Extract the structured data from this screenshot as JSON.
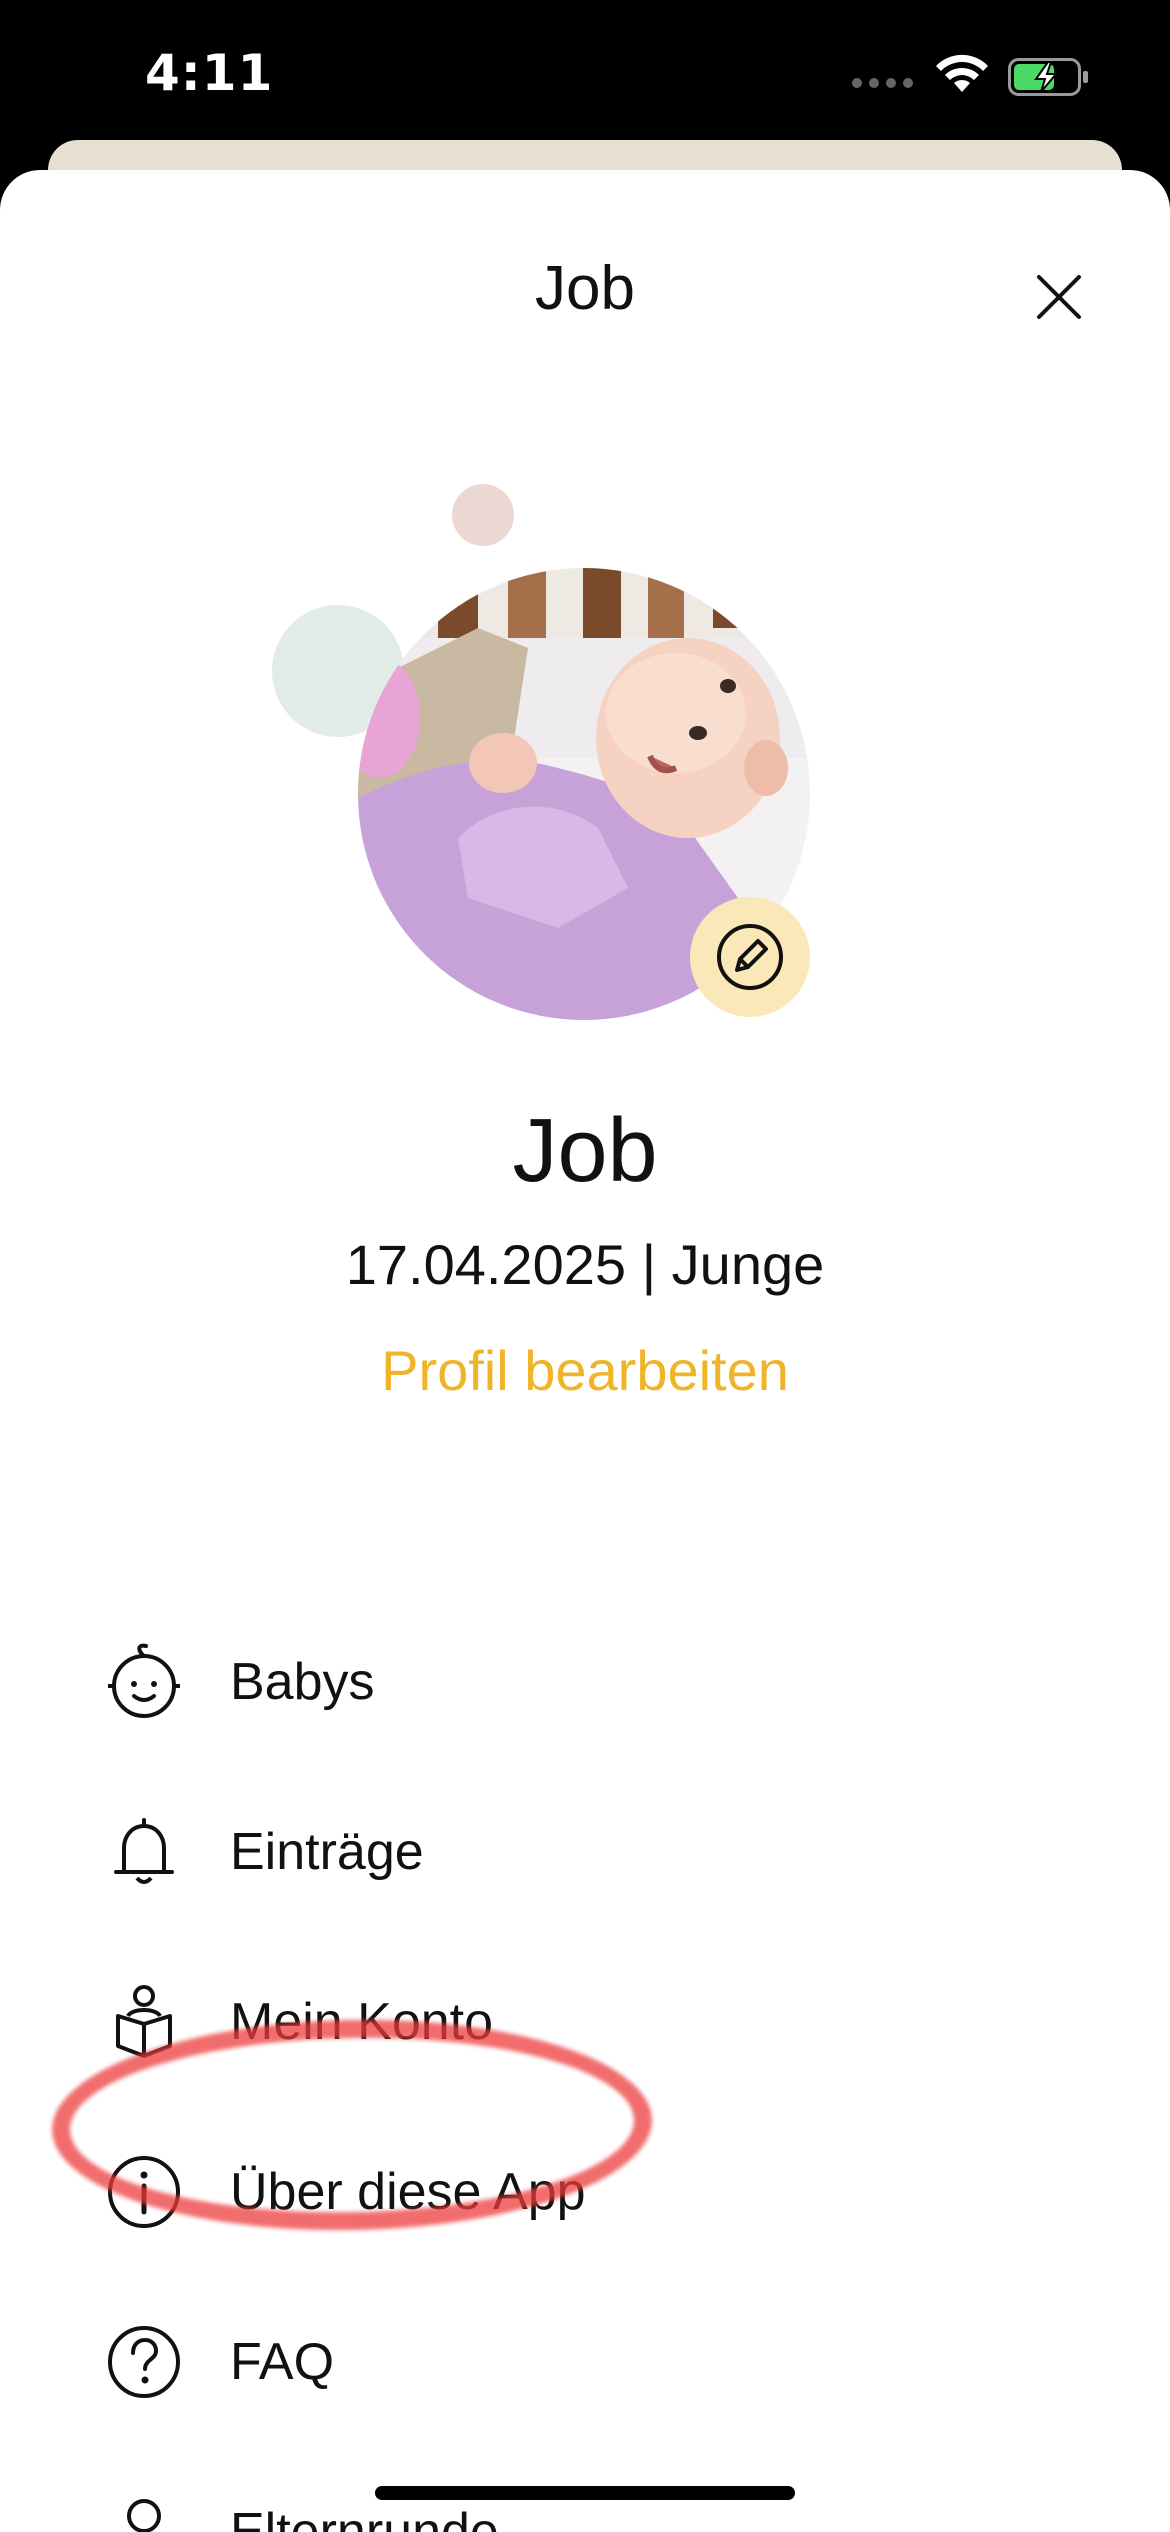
{
  "status_bar": {
    "time": "4:11"
  },
  "sheet": {
    "title": "Job"
  },
  "profile": {
    "name": "Job",
    "meta": "17.04.2025 | Junge",
    "edit_link": "Profil bearbeiten"
  },
  "menu": {
    "items": [
      {
        "label": "Babys",
        "icon": "baby-face-icon"
      },
      {
        "label": "Einträge",
        "icon": "bell-icon"
      },
      {
        "label": "Mein Konto",
        "icon": "person-reading-icon"
      },
      {
        "label": "Über diese App",
        "icon": "info-icon"
      },
      {
        "label": "FAQ",
        "icon": "question-icon"
      },
      {
        "label": "Elternrunde",
        "icon": "person-icon"
      }
    ]
  },
  "colors": {
    "accent": "#f0b429",
    "edit_badge": "#fbe8b8",
    "highlight": "#ec3c3c"
  }
}
